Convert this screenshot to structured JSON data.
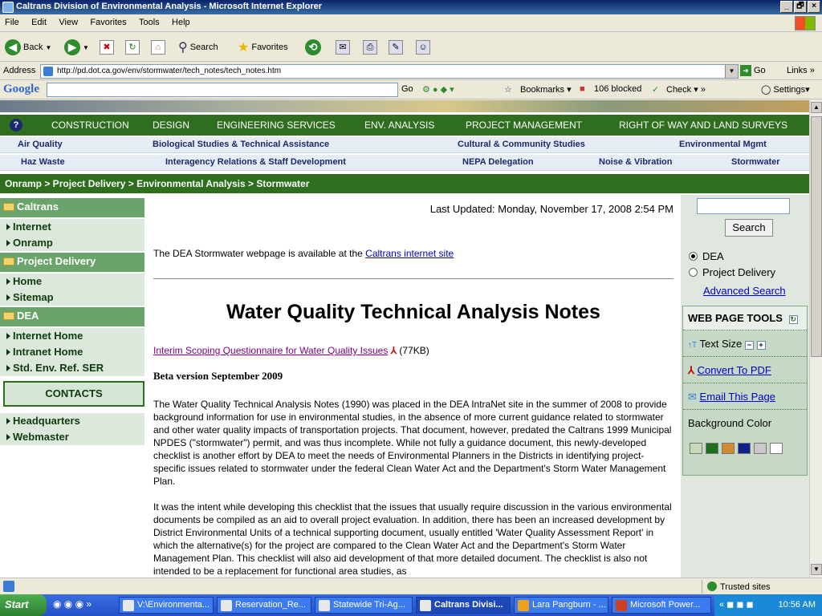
{
  "window": {
    "title": "Caltrans Division of Environmental Analysis - Microsoft Internet Explorer",
    "min": "_",
    "max": "🗗",
    "close": "×"
  },
  "menu": [
    "File",
    "Edit",
    "View",
    "Favorites",
    "Tools",
    "Help"
  ],
  "toolbar": {
    "back": "Back",
    "search": "Search",
    "favorites": "Favorites"
  },
  "address": {
    "label": "Address",
    "url": "http://pd.dot.ca.gov/env/stormwater/tech_notes/tech_notes.htm",
    "go": "Go",
    "links": "Links"
  },
  "gbar": {
    "logo": "Google",
    "go": "Go",
    "bookmarks": "Bookmarks",
    "blocked": "106 blocked",
    "check": "Check",
    "settings": "Settings"
  },
  "topnav": [
    "CONSTRUCTION",
    "DESIGN",
    "ENGINEERING SERVICES",
    "ENV. ANALYSIS",
    "PROJECT MANAGEMENT",
    "RIGHT OF WAY AND LAND SURVEYS"
  ],
  "subnav1": [
    "Air Quality",
    "Biological Studies & Technical Assistance",
    "Cultural & Community Studies",
    "Environmental Mgmt"
  ],
  "subnav2": [
    "Haz Waste",
    "Interagency Relations & Staff Development",
    "NEPA Delegation",
    "Noise & Vibration",
    "Stormwater"
  ],
  "breadcrumb": "Onramp > Project Delivery > Environmental Analysis > Stormwater",
  "leftnav": {
    "caltrans": "Caltrans",
    "internet": "Internet",
    "onramp": "Onramp",
    "project_delivery": "Project Delivery",
    "home": "Home",
    "sitemap": "Sitemap",
    "dea": "DEA",
    "internet_home": "Internet Home",
    "intranet_home": "Intranet Home",
    "std_env_ref": "Std. Env. Ref. SER",
    "contacts": "CONTACTS",
    "headquarters": "Headquarters",
    "webmaster": "Webmaster"
  },
  "main": {
    "last_updated": "Last Updated: Monday, November 17, 2008 2:54 PM",
    "dea_text": "The DEA Stormwater webpage is available at the",
    "dea_link": "Caltrans internet site",
    "heading": "Water Quality Technical Analysis Notes",
    "questionnaire_link": "Interim Scoping Questionnaire for Water Quality Issues",
    "questionnaire_size": "(77KB)",
    "beta": "Beta version September 2009",
    "para1": "The Water Quality Technical Analysis Notes (1990) was placed in the DEA IntraNet site in the summer of 2008 to provide background information for use in environmental studies, in the absence of more current guidance related to stormwater and other water quality impacts of transportation projects. That document, however, predated the Caltrans 1999 Municipal NPDES (\"stormwater\") permit, and was thus incomplete. While not fully a guidance document, this newly-developed checklist is another effort by DEA to meet the needs of Environmental Planners in the Districts in identifying project-specific issues related to stormwater under the federal Clean Water Act and the Department's Storm Water Management Plan.",
    "para2": "It was the intent while developing this checklist that the issues that usually require discussion in the various environmental documents be compiled as an aid to overall project evaluation. In addition, there has been an increased development by District Environmental Units of a technical supporting document, usually entitled 'Water Quality Assessment Report' in which the alternative(s) for the project are compared to the Clean Water Act and the Department's Storm Water Management Plan. This checklist will also aid development of that more detailed document. The checklist is also not intended to be a replacement for functional area studies, as"
  },
  "rightbar": {
    "search_value": "",
    "search_button": "Search",
    "radio_dea": "DEA",
    "radio_pd": "Project Delivery",
    "advanced": "Advanced Search",
    "tools_title": "WEB PAGE TOOLS",
    "text_size": "Text Size",
    "convert_pdf": "Convert To PDF",
    "email": "Email This Page",
    "bg_color": "Background Color",
    "swatches": [
      "#c8d8b8",
      "#1e6e1e",
      "#d08a30",
      "#10208a",
      "#c8c8c8",
      "#ffffff"
    ]
  },
  "status": {
    "zone": "Trusted sites"
  },
  "taskbar": {
    "start": "Start",
    "tasks": [
      "V:\\Environmenta...",
      "Reservation_Re...",
      "Statewide Tri-Ag...",
      "Caltrans Divisi...",
      "Lara Pangburn - ...",
      "Microsoft Power..."
    ],
    "clock": "10:56 AM"
  }
}
